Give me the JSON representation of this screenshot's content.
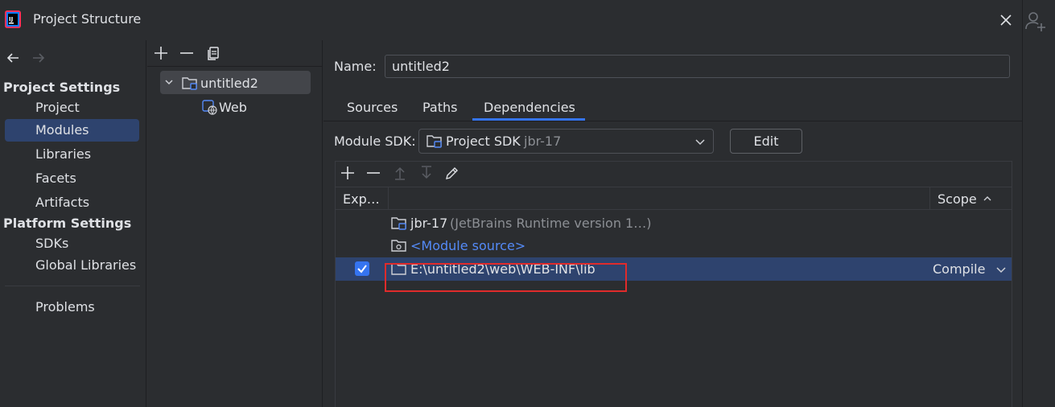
{
  "window": {
    "title": "Project Structure"
  },
  "nav": {
    "project_settings_header": "Project Settings",
    "project_settings_items": [
      "Project",
      "Modules",
      "Libraries",
      "Facets",
      "Artifacts"
    ],
    "platform_settings_header": "Platform Settings",
    "platform_settings_items": [
      "SDKs",
      "Global Libraries"
    ],
    "problems": "Problems",
    "selected": "Modules"
  },
  "tree": {
    "module": "untitled2",
    "facet": "Web"
  },
  "module": {
    "name_label": "Name:",
    "name_value": "untitled2",
    "tabs": [
      "Sources",
      "Paths",
      "Dependencies"
    ],
    "active_tab": "Dependencies",
    "sdk_label": "Module SDK:",
    "sdk_value": "Project SDK",
    "sdk_hint": "jbr-17",
    "edit_label": "Edit"
  },
  "dependencies": {
    "columns": {
      "export": "Exp…",
      "scope": "Scope"
    },
    "rows": [
      {
        "name": "jbr-17",
        "detail": "(JetBrains Runtime version 1…)",
        "scope": "",
        "checked": null
      },
      {
        "name": "<Module source>",
        "detail": "",
        "scope": "",
        "checked": null
      },
      {
        "name": "E:\\untitled2\\web\\WEB-INF\\lib",
        "detail": "",
        "scope": "Compile",
        "checked": true
      }
    ]
  },
  "colors": {
    "selection": "#2e436e",
    "accent": "#3574f0",
    "highlight_box": "#e02b2b",
    "link": "#548af7"
  }
}
